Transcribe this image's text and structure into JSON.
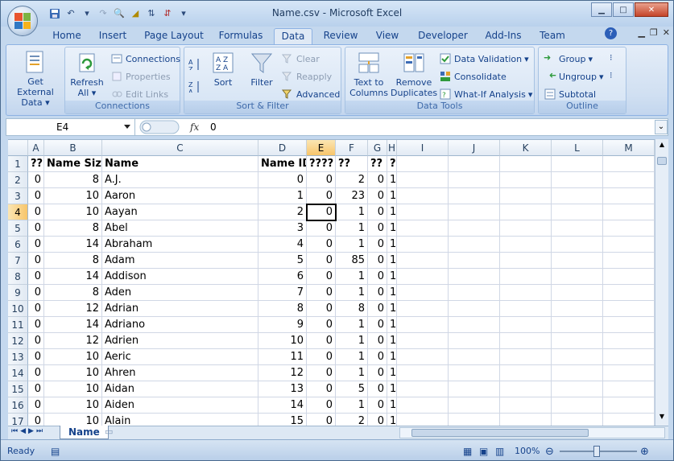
{
  "window": {
    "title": "Name.csv - Microsoft Excel"
  },
  "tabs": [
    "Home",
    "Insert",
    "Page Layout",
    "Formulas",
    "Data",
    "Review",
    "View",
    "Developer",
    "Add-Ins",
    "Team"
  ],
  "active_tab": "Data",
  "ribbon": {
    "groups": {
      "connections": "Connections",
      "sort_filter": "Sort & Filter",
      "data_tools": "Data Tools",
      "outline": "Outline"
    },
    "get_external_data": [
      "Get External",
      "Data"
    ],
    "refresh_all": [
      "Refresh",
      "All"
    ],
    "connections": "Connections",
    "properties": "Properties",
    "edit_links": "Edit Links",
    "sort": "Sort",
    "filter": "Filter",
    "clear": "Clear",
    "reapply": "Reapply",
    "advanced": "Advanced",
    "text_to_columns": [
      "Text to",
      "Columns"
    ],
    "remove_duplicates": [
      "Remove",
      "Duplicates"
    ],
    "data_validation": "Data Validation",
    "consolidate": "Consolidate",
    "what_if": "What-If Analysis",
    "group": "Group",
    "ungroup": "Ungroup",
    "subtotal": "Subtotal"
  },
  "formula_bar": {
    "name_box": "E4",
    "fx": "fx",
    "value": "0"
  },
  "columns": [
    "A",
    "B",
    "C",
    "D",
    "E",
    "F",
    "G",
    "H",
    "I",
    "J",
    "K",
    "L",
    "M"
  ],
  "rows": [
    [
      "??",
      "Name Size",
      "Name",
      "Name ID",
      "????",
      "??",
      "??",
      "?"
    ],
    [
      "0",
      "8",
      "A.J.",
      "0",
      "0",
      "2",
      "0",
      "1"
    ],
    [
      "0",
      "10",
      "Aaron",
      "1",
      "0",
      "23",
      "0",
      "1"
    ],
    [
      "0",
      "10",
      "Aayan",
      "2",
      "0",
      "1",
      "0",
      "1"
    ],
    [
      "0",
      "8",
      "Abel",
      "3",
      "0",
      "1",
      "0",
      "1"
    ],
    [
      "0",
      "14",
      "Abraham",
      "4",
      "0",
      "1",
      "0",
      "1"
    ],
    [
      "0",
      "8",
      "Adam",
      "5",
      "0",
      "85",
      "0",
      "1"
    ],
    [
      "0",
      "14",
      "Addison",
      "6",
      "0",
      "1",
      "0",
      "1"
    ],
    [
      "0",
      "8",
      "Aden",
      "7",
      "0",
      "1",
      "0",
      "1"
    ],
    [
      "0",
      "12",
      "Adrian",
      "8",
      "0",
      "8",
      "0",
      "1"
    ],
    [
      "0",
      "14",
      "Adriano",
      "9",
      "0",
      "1",
      "0",
      "1"
    ],
    [
      "0",
      "12",
      "Adrien",
      "10",
      "0",
      "1",
      "0",
      "1"
    ],
    [
      "0",
      "10",
      "Aeric",
      "11",
      "0",
      "1",
      "0",
      "1"
    ],
    [
      "0",
      "10",
      "Ahren",
      "12",
      "0",
      "1",
      "0",
      "1"
    ],
    [
      "0",
      "10",
      "Aidan",
      "13",
      "0",
      "5",
      "0",
      "1"
    ],
    [
      "0",
      "10",
      "Aiden",
      "14",
      "0",
      "1",
      "0",
      "1"
    ],
    [
      "0",
      "10",
      "Alain",
      "15",
      "0",
      "2",
      "0",
      "1"
    ]
  ],
  "sheet_tab": "Name",
  "status": {
    "ready": "Ready",
    "zoom": "100%"
  }
}
